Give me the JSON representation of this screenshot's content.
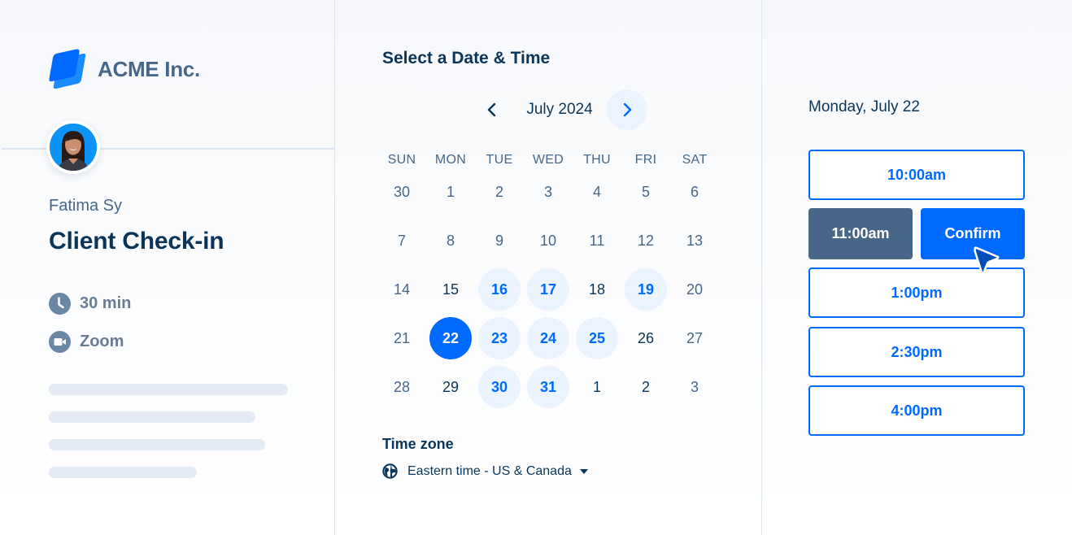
{
  "brand": {
    "name": "ACME Inc.",
    "logo_icon": "stacked-squares-logo",
    "accent_color": "#0069ff"
  },
  "host": {
    "name": "Fatima Sy",
    "avatar": "profile-photo"
  },
  "event": {
    "title": "Client Check-in",
    "duration": "30 min",
    "duration_icon": "clock-icon",
    "location": "Zoom",
    "location_icon": "video-camera-icon"
  },
  "scheduler": {
    "title": "Select a Date & Time",
    "month_label": "July 2024",
    "prev_icon": "chevron-left-icon",
    "next_icon": "chevron-right-icon",
    "weekdays": [
      "SUN",
      "MON",
      "TUE",
      "WED",
      "THU",
      "FRI",
      "SAT"
    ],
    "weeks": [
      [
        {
          "day": "30",
          "state": "muted"
        },
        {
          "day": "1",
          "state": "muted"
        },
        {
          "day": "2",
          "state": "muted"
        },
        {
          "day": "3",
          "state": "muted"
        },
        {
          "day": "4",
          "state": "muted"
        },
        {
          "day": "5",
          "state": "muted"
        },
        {
          "day": "6",
          "state": "muted"
        }
      ],
      [
        {
          "day": "7",
          "state": "muted"
        },
        {
          "day": "8",
          "state": "muted"
        },
        {
          "day": "9",
          "state": "muted"
        },
        {
          "day": "10",
          "state": "muted"
        },
        {
          "day": "11",
          "state": "muted"
        },
        {
          "day": "12",
          "state": "muted"
        },
        {
          "day": "13",
          "state": "muted"
        }
      ],
      [
        {
          "day": "14",
          "state": "muted"
        },
        {
          "day": "15",
          "state": "weekday"
        },
        {
          "day": "16",
          "state": "available"
        },
        {
          "day": "17",
          "state": "available"
        },
        {
          "day": "18",
          "state": "weekday"
        },
        {
          "day": "19",
          "state": "available"
        },
        {
          "day": "20",
          "state": "muted"
        }
      ],
      [
        {
          "day": "21",
          "state": "muted"
        },
        {
          "day": "22",
          "state": "selected"
        },
        {
          "day": "23",
          "state": "available"
        },
        {
          "day": "24",
          "state": "available"
        },
        {
          "day": "25",
          "state": "available"
        },
        {
          "day": "26",
          "state": "weekday"
        },
        {
          "day": "27",
          "state": "muted"
        }
      ],
      [
        {
          "day": "28",
          "state": "muted"
        },
        {
          "day": "29",
          "state": "weekday"
        },
        {
          "day": "30",
          "state": "available"
        },
        {
          "day": "31",
          "state": "available"
        },
        {
          "day": "1",
          "state": "weekday"
        },
        {
          "day": "2",
          "state": "weekday"
        },
        {
          "day": "3",
          "state": "muted"
        }
      ]
    ],
    "timezone_label": "Time zone",
    "timezone_value": "Eastern time - US & Canada",
    "timezone_icon": "globe-icon"
  },
  "times": {
    "selected_date": "Monday, July 22",
    "slots": [
      "10:00am",
      "1:00pm",
      "2:30pm",
      "4:00pm"
    ],
    "selected_slot": "11:00am",
    "confirm_label": "Confirm"
  }
}
